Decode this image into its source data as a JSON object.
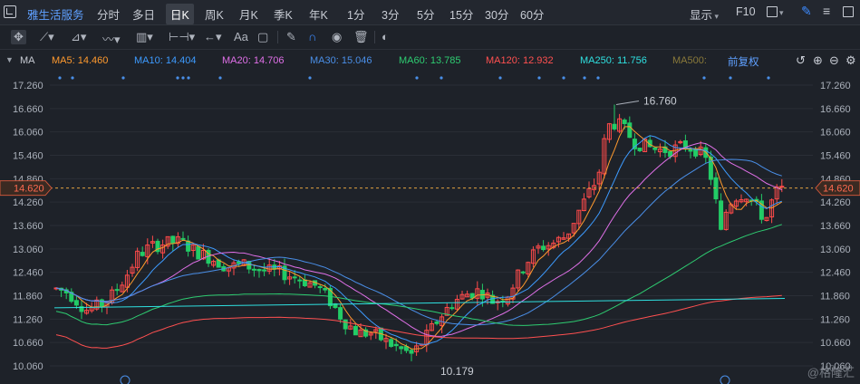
{
  "topbar": {
    "stock_name": "雅生活服务",
    "periods": [
      "分时",
      "多日",
      "日K",
      "周K",
      "月K",
      "季K",
      "年K",
      "1分",
      "3分",
      "5分",
      "15分",
      "30分",
      "60分"
    ],
    "active_period": "日K",
    "display_label": "显示",
    "f10_label": "F10"
  },
  "toolbar": {
    "text_tool_label": "Aa"
  },
  "ma_legend": [
    {
      "label": "MA",
      "value": "",
      "color": "#c8ccd4"
    },
    {
      "label": "MA5:",
      "value": "14.460",
      "color": "#ff9a2e"
    },
    {
      "label": "MA10:",
      "value": "14.404",
      "color": "#3d9bff"
    },
    {
      "label": "MA20:",
      "value": "14.706",
      "color": "#e070e8"
    },
    {
      "label": "MA30:",
      "value": "15.046",
      "color": "#4a8fe8"
    },
    {
      "label": "MA60:",
      "value": "13.785",
      "color": "#2ecc71"
    },
    {
      "label": "MA120:",
      "value": "12.932",
      "color": "#ff5050"
    },
    {
      "label": "MA250:",
      "value": "11.756",
      "color": "#2fe0e0"
    },
    {
      "label": "MA500:",
      "value": "",
      "color": "#8a7a3a"
    }
  ],
  "adjust_label": "前复权",
  "chart_data": {
    "type": "candlestick",
    "y_ticks": [
      "17.260",
      "16.660",
      "16.060",
      "15.460",
      "14.860",
      "14.260",
      "13.660",
      "13.060",
      "12.460",
      "11.860",
      "11.260",
      "10.660",
      "10.060"
    ],
    "ylim": [
      10.06,
      17.26
    ],
    "current_price": "14.620",
    "high_label": "16.760",
    "low_label": "10.179",
    "bottom_right_tick": "10.060",
    "up_color": "#ff4a4a",
    "down_color": "#22cc66"
  },
  "watermark": "@格隆汇"
}
